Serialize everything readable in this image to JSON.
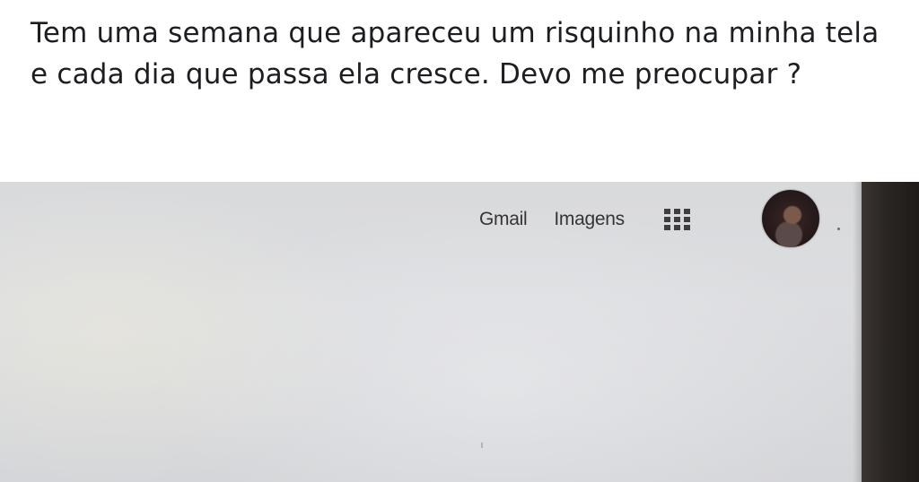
{
  "post": {
    "caption": "Tem uma semana que apareceu um risquinho na minha tela e cada dia que passa ela cresce. Devo me preocupar ?"
  },
  "screen": {
    "header_links": {
      "gmail": "Gmail",
      "images": "Imagens"
    },
    "apps_icon": "apps-grid-icon",
    "account_icon": "user-avatar"
  },
  "colors": {
    "page_background": "#ffffff",
    "caption_text": "#1c1e21",
    "screen_background": "#d9dadc",
    "link_text": "#353536",
    "monitor_bezel": "#2b2624"
  }
}
